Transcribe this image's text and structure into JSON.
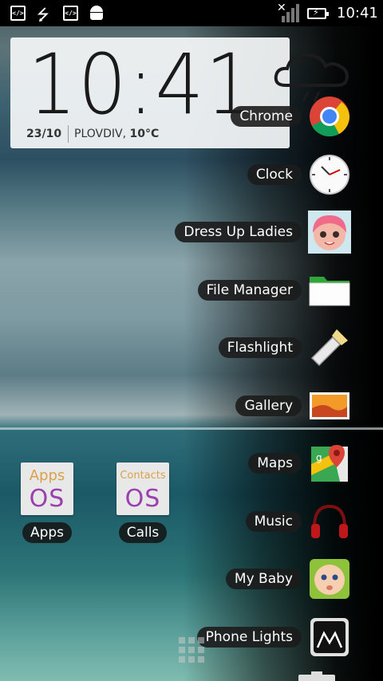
{
  "status_bar": {
    "time": "10:41",
    "icons": [
      "code-icon",
      "usb-icon",
      "code-icon",
      "android-icon",
      "signal-icon",
      "battery-charging-icon"
    ]
  },
  "clock_widget": {
    "time": "10:41",
    "date": "23/10",
    "city": "PLOVDIV,",
    "temperature": "10°C",
    "weather_icon": "cloud-rain-icon"
  },
  "home_apps": [
    {
      "label": "Apps",
      "tile_small": "Apps",
      "tile_big": "OS"
    },
    {
      "label": "Calls",
      "tile_small": "Contacts",
      "tile_big": "OS"
    }
  ],
  "app_list": [
    {
      "label": "Chrome",
      "icon": "chrome-icon"
    },
    {
      "label": "Clock",
      "icon": "clock-icon"
    },
    {
      "label": "Dress Up Ladies",
      "icon": "girl-face-icon"
    },
    {
      "label": "File Manager",
      "icon": "folder-icon"
    },
    {
      "label": "Flashlight",
      "icon": "flashlight-icon"
    },
    {
      "label": "Gallery",
      "icon": "gallery-icon"
    },
    {
      "label": "Maps",
      "icon": "maps-icon"
    },
    {
      "label": "Music",
      "icon": "headphones-icon"
    },
    {
      "label": "My Baby",
      "icon": "baby-icon"
    },
    {
      "label": "Phone Lights",
      "icon": "phone-lights-icon"
    }
  ],
  "colors": {
    "pill_bg": "#1c1c1c",
    "widget_bg": "#f4f6f7",
    "os_purple": "#9a3fb0",
    "os_orange": "#d9a24a"
  }
}
